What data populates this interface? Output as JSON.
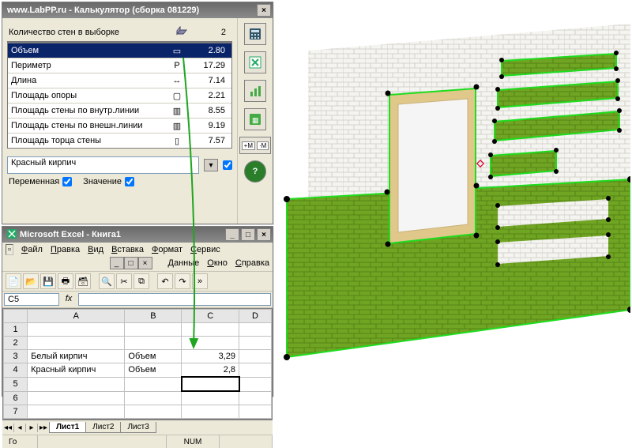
{
  "calc": {
    "title": "www.LabPP.ru - Калькулятор (сборка 081229)",
    "header": {
      "label": "Количество стен в выборке",
      "value": "2"
    },
    "rows": [
      {
        "name": "Объем",
        "value": "2.80",
        "selected": true
      },
      {
        "name": "Периметр",
        "value": "17.29",
        "selected": false
      },
      {
        "name": "Длина",
        "value": "7.14",
        "selected": false
      },
      {
        "name": "Площадь опоры",
        "value": "2.21",
        "selected": false
      },
      {
        "name": "Площадь стены по внутр.линии",
        "value": "8.55",
        "selected": false
      },
      {
        "name": "Площадь стены по внешн.линии",
        "value": "9.19",
        "selected": false
      },
      {
        "name": "Площадь торца стены",
        "value": "7.57",
        "selected": false
      }
    ],
    "material": "Красный кирпич",
    "material_chk": true,
    "var_label": "Переменная",
    "var_chk": true,
    "val_label": "Значение",
    "val_chk": true,
    "tools": [
      "calc-tool",
      "excel-link-tool",
      "chart-tool",
      "write-tool",
      "mult-tool",
      "help-tool"
    ]
  },
  "excel": {
    "title": "Microsoft Excel - Книга1",
    "menu": [
      "Файл",
      "Правка",
      "Вид",
      "Вставка",
      "Формат",
      "Сервис",
      "Данные",
      "Окно",
      "Справка"
    ],
    "namebox": "C5",
    "columns": [
      "",
      "A",
      "B",
      "C",
      "D"
    ],
    "rows": [
      {
        "n": "1",
        "cells": [
          "",
          "",
          "",
          ""
        ]
      },
      {
        "n": "2",
        "cells": [
          "",
          "",
          "",
          ""
        ]
      },
      {
        "n": "3",
        "cells": [
          "Белый кирпич",
          "Объем",
          "3,29",
          ""
        ]
      },
      {
        "n": "4",
        "cells": [
          "Красный кирпич",
          "Объем",
          "2,8",
          ""
        ]
      },
      {
        "n": "5",
        "cells": [
          "",
          "",
          "",
          ""
        ],
        "selcol": 2
      },
      {
        "n": "6",
        "cells": [
          "",
          "",
          "",
          ""
        ]
      },
      {
        "n": "7",
        "cells": [
          "",
          "",
          "",
          ""
        ]
      }
    ],
    "tabs": [
      "Лист1",
      "Лист2",
      "Лист3"
    ],
    "active_tab": 0,
    "status": {
      "ready": "Го",
      "num": "NUM"
    }
  }
}
